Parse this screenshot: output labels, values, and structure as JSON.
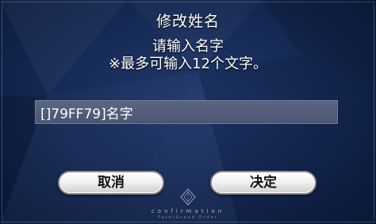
{
  "dialog": {
    "title": "修改姓名",
    "prompt_line1": "请输入名字",
    "prompt_line2": "※最多可输入12个文字。"
  },
  "name_field": {
    "value": "[]79FF79]名字"
  },
  "buttons": {
    "cancel_label": "取消",
    "confirm_label": "决定"
  },
  "footer": {
    "label": "confirmation",
    "sublabel": "Fate/Grand Order"
  },
  "colors": {
    "background": "#162b57",
    "button_face": "#f2f2f2",
    "input_bg": "#4a5672"
  },
  "icons": {
    "emblem": "fgo-emblem-icon"
  }
}
